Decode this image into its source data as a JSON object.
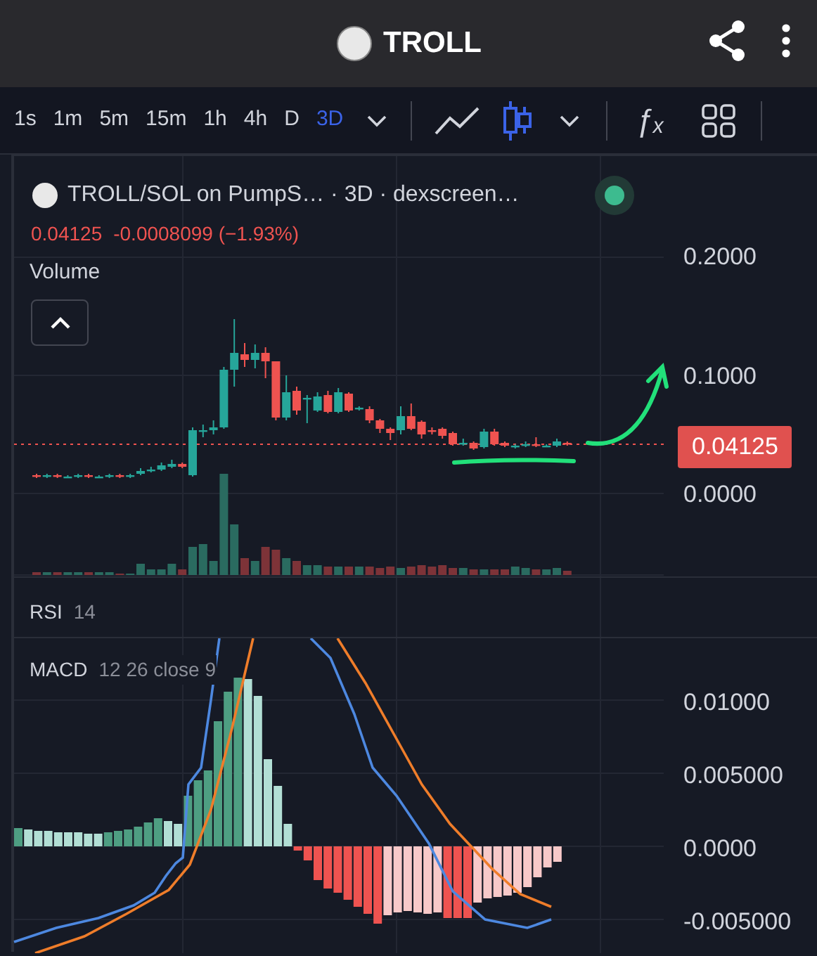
{
  "header": {
    "title": "TROLL"
  },
  "intervals": [
    {
      "label": "1s",
      "selected": false
    },
    {
      "label": "1m",
      "selected": false
    },
    {
      "label": "5m",
      "selected": false
    },
    {
      "label": "15m",
      "selected": false
    },
    {
      "label": "1h",
      "selected": false
    },
    {
      "label": "4h",
      "selected": false
    },
    {
      "label": "D",
      "selected": false
    },
    {
      "label": "3D",
      "selected": true
    }
  ],
  "chart_types": [
    {
      "kind": "line",
      "selected": false
    },
    {
      "kind": "candles",
      "selected": true
    }
  ],
  "indicators_button": "ƒₓ",
  "legend": {
    "title": "TROLL/SOL on PumpS… · 3D · dexscreen…",
    "price": "0.04125",
    "change": "-0.0008099 (−1.93%)"
  },
  "volume_label": "Volume",
  "price_axis": [
    "0.2000",
    "0.1000",
    "0.0000"
  ],
  "last_price_badge": "0.04125",
  "rsi": {
    "name": "RSI",
    "params": "14"
  },
  "macd": {
    "name": "MACD",
    "params": "12 26 close 9"
  },
  "macd_axis": [
    "0.01000",
    "0.005000",
    "0.0000",
    "-0.005000"
  ]
}
